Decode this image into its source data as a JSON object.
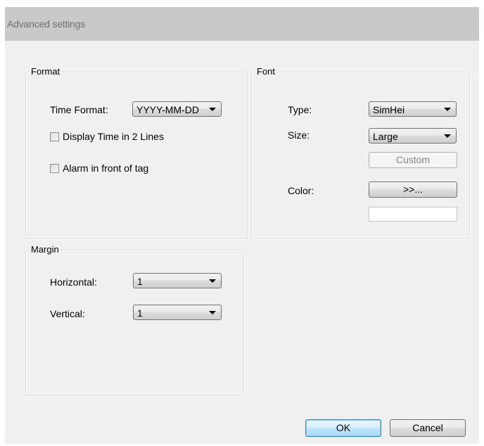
{
  "window": {
    "title": "Advanced settings"
  },
  "format": {
    "group_label": "Format",
    "time_format_label": "Time Format:",
    "time_format_value": "YYYY-MM-DD",
    "display_time_two_lines_label": "Display Time in 2 Lines",
    "display_time_two_lines_checked": false,
    "alarm_front_of_tag_label": "Alarm in front of tag",
    "alarm_front_of_tag_checked": false
  },
  "font": {
    "group_label": "Font",
    "type_label": "Type:",
    "type_value": "SimHei",
    "size_label": "Size:",
    "size_value": "Large",
    "custom_button_label": "Custom",
    "color_label": "Color:",
    "color_button_label": ">>...",
    "color_value": "#ffffff"
  },
  "margin": {
    "group_label": "Margin",
    "horizontal_label": "Horizontal:",
    "horizontal_value": "1",
    "vertical_label": "Vertical:",
    "vertical_value": "1"
  },
  "buttons": {
    "ok_label": "OK",
    "cancel_label": "Cancel"
  }
}
